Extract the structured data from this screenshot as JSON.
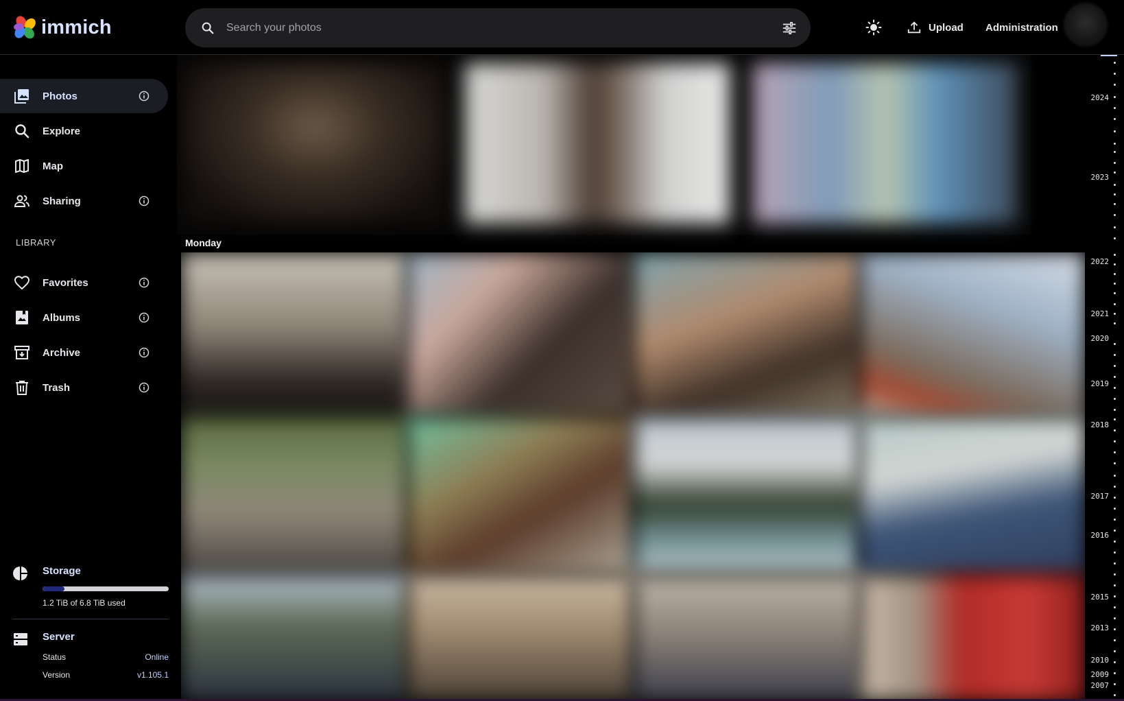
{
  "app": {
    "name": "immich",
    "brand_colors": [
      "#e6433a",
      "#fbbc05",
      "#34a853",
      "#4285f4",
      "#9b5bd4"
    ],
    "accent": "#d7e2ff"
  },
  "header": {
    "search_placeholder": "Search your photos",
    "upload_label": "Upload",
    "admin_label": "Administration",
    "icons": [
      "search-icon",
      "tune-icon",
      "sun-icon",
      "upload-icon",
      "avatar"
    ]
  },
  "sidebar": {
    "items": [
      {
        "label": "Photos",
        "icon": "photos-icon",
        "active": true,
        "info": true
      },
      {
        "label": "Explore",
        "icon": "search-icon",
        "active": false,
        "info": false
      },
      {
        "label": "Map",
        "icon": "map-icon",
        "active": false,
        "info": false
      },
      {
        "label": "Sharing",
        "icon": "sharing-icon",
        "active": false,
        "info": true
      }
    ],
    "library_label": "LIBRARY",
    "library_items": [
      {
        "label": "Favorites",
        "icon": "heart-icon",
        "info": true
      },
      {
        "label": "Albums",
        "icon": "album-icon",
        "info": true
      },
      {
        "label": "Archive",
        "icon": "archive-icon",
        "info": true
      },
      {
        "label": "Trash",
        "icon": "trash-icon",
        "info": true
      }
    ],
    "storage": {
      "title": "Storage",
      "used_text": "1.2 TiB of 6.8 TiB used",
      "fraction": 0.176
    },
    "server": {
      "title": "Server",
      "status_label": "Status",
      "status_value": "Online",
      "version_label": "Version",
      "version_value": "v1.105.1"
    }
  },
  "main": {
    "day_label": "Monday"
  },
  "timeline": {
    "years": [
      "2024",
      "2023",
      "2022",
      "2021",
      "2020",
      "2019",
      "2018",
      "2017",
      "2016",
      "2015",
      "2013",
      "2010",
      "2009",
      "2007"
    ]
  }
}
